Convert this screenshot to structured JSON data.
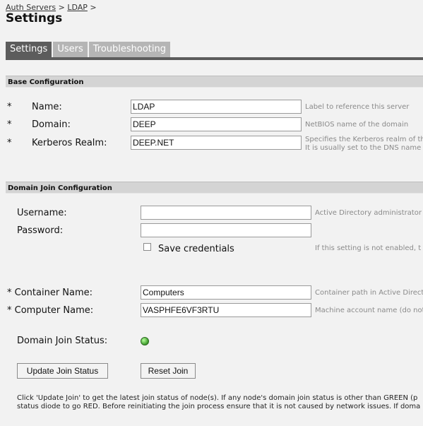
{
  "breadcrumb": {
    "item1": "Auth Servers",
    "sep1": ">",
    "item2": "LDAP",
    "sep2": ">"
  },
  "page_title": "Settings",
  "tabs": [
    {
      "label": "Settings",
      "active": true
    },
    {
      "label": "Users",
      "active": false
    },
    {
      "label": "Troubleshooting",
      "active": false
    }
  ],
  "base_config": {
    "heading": "Base Configuration",
    "required_marker": "*",
    "name": {
      "label": "Name:",
      "value": "LDAP",
      "help": "Label to reference this server"
    },
    "domain": {
      "label": "Domain:",
      "value": "DEEP",
      "help": "NetBIOS name of the domain"
    },
    "realm": {
      "label": "Kerberos Realm:",
      "value": "DEEP.NET",
      "help1": "Specifies the Kerberos realm of th",
      "help2": "It is usually set to the DNS name"
    }
  },
  "domain_join": {
    "heading": "Domain Join Configuration",
    "username": {
      "label": "Username:",
      "value": "",
      "help": "Active Directory administrator"
    },
    "password": {
      "label": "Password:",
      "value": ""
    },
    "save_credentials": {
      "label": "Save credentials",
      "checked": false,
      "help": "If this setting is not enabled, t"
    },
    "container": {
      "label": "* Container Name:",
      "value": "Computers",
      "help": "Container path in Active Direct"
    },
    "computer": {
      "label": "* Computer Name:",
      "value": "VASPHFE6VF3RTU",
      "help": "Machine account name (do not"
    },
    "status": {
      "label": "Domain Join Status:",
      "color": "#4caf50"
    },
    "update_button": "Update Join Status",
    "reset_button": "Reset Join",
    "note_line1": "Click 'Update Join' to get the latest join status of node(s). If any node's domain join status is other than GREEN (p",
    "note_line2": "status diode to go RED. Before reinitiating the join process ensure that it is not caused by network issues. If doma"
  }
}
